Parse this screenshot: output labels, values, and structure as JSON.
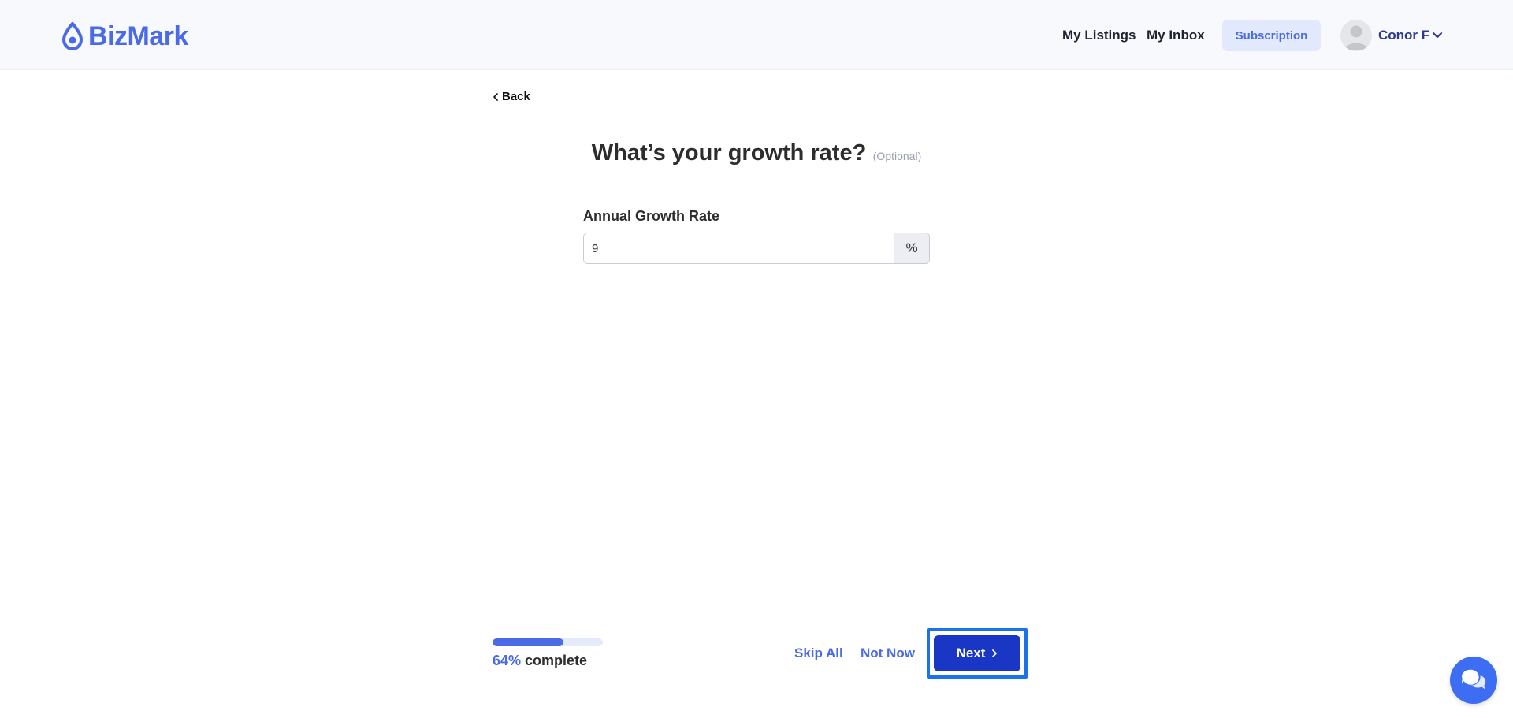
{
  "brand": {
    "name": "BizMark",
    "color": "#4a6ae6"
  },
  "header": {
    "nav": [
      "My Listings",
      "My Inbox"
    ],
    "subscription_label": "Subscription",
    "user_name": "Conor F"
  },
  "page": {
    "back_label": "Back",
    "title": "What’s your growth rate?",
    "optional_label": "(Optional)",
    "field_label": "Annual Growth Rate",
    "field_value": "9",
    "field_suffix": "%"
  },
  "footer": {
    "progress_percent_label": "64%",
    "progress_suffix": "complete",
    "progress_value": 0.64,
    "skip_all_label": "Skip All",
    "not_now_label": "Not Now",
    "next_label": "Next"
  },
  "colors": {
    "accent": "#4a6ae6",
    "primary_button": "#1a36c4",
    "focus_outline": "#1a73e8",
    "chat_button": "#3d6df2"
  },
  "icons": [
    "logo-drop-icon",
    "chevron-down-icon",
    "chevron-left-icon",
    "chevron-right-icon",
    "chat-icon",
    "avatar-icon"
  ]
}
